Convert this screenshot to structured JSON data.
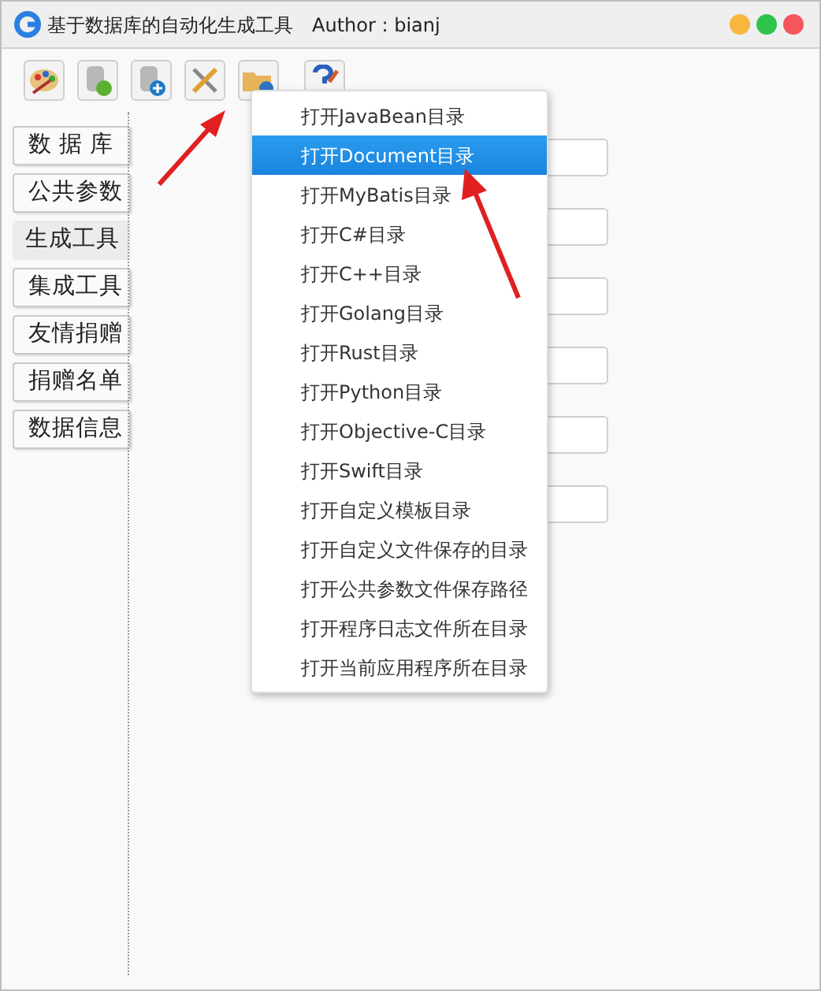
{
  "window": {
    "title": "基于数据库的自动化生成工具",
    "author": "Author : bianj"
  },
  "sidebar": {
    "items": [
      {
        "label": "数 据 库",
        "selected": false
      },
      {
        "label": "公共参数",
        "selected": false
      },
      {
        "label": "生成工具",
        "selected": true
      },
      {
        "label": "集成工具",
        "selected": false
      },
      {
        "label": "友情捐赠",
        "selected": false
      },
      {
        "label": "捐赠名单",
        "selected": false
      },
      {
        "label": "数据信息",
        "selected": false
      }
    ]
  },
  "menu": {
    "items": [
      {
        "label": "打开JavaBean目录",
        "selected": false
      },
      {
        "label": "打开Document目录",
        "selected": true
      },
      {
        "label": "打开MyBatis目录",
        "selected": false
      },
      {
        "label": "打开C#目录",
        "selected": false
      },
      {
        "label": "打开C++目录",
        "selected": false
      },
      {
        "label": "打开Golang目录",
        "selected": false
      },
      {
        "label": "打开Rust目录",
        "selected": false
      },
      {
        "label": "打开Python目录",
        "selected": false
      },
      {
        "label": "打开Objective-C目录",
        "selected": false
      },
      {
        "label": "打开Swift目录",
        "selected": false
      },
      {
        "label": "打开自定义模板目录",
        "selected": false
      },
      {
        "label": "打开自定义文件保存的目录",
        "selected": false
      },
      {
        "label": "打开公共参数文件保存路径",
        "selected": false
      },
      {
        "label": "打开程序日志文件所在目录",
        "selected": false
      },
      {
        "label": "打开当前应用程序所在目录",
        "selected": false
      }
    ]
  }
}
